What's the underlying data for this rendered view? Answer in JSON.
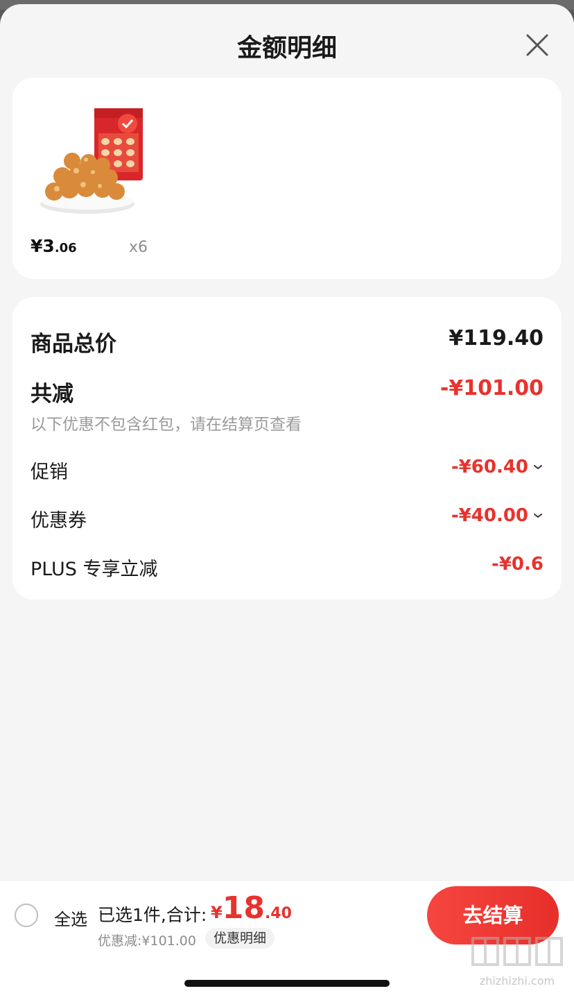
{
  "sheet": {
    "title": "金额明细"
  },
  "product": {
    "price_symbol": "¥",
    "price_integer": "3",
    "price_decimal": ".06",
    "quantity": "x6"
  },
  "summary": {
    "total_label": "商品总价",
    "total_value": "¥119.40",
    "reduce_label": "共减",
    "reduce_value": "-¥101.00",
    "note": "以下优惠不包含红包，请在结算页查看",
    "promo_label": "促销",
    "promo_value": "-¥60.40",
    "coupon_label": "优惠券",
    "coupon_value": "-¥40.00",
    "plus_label": "PLUS 专享立减",
    "plus_value": "-¥0.6"
  },
  "bottom_bar": {
    "select_all": "全选",
    "selected_text": "已选1件,合计:",
    "sum_symbol": "¥",
    "sum_integer": "18",
    "sum_decimal": ".40",
    "discount_text": "优惠减:¥101.00",
    "detail_chip": "优惠明细",
    "checkout": "去结算"
  },
  "watermark": {
    "text": "zhizhizhi.com"
  },
  "colors": {
    "accent_red": "#e8322d",
    "sheet_bg": "#f5f5f5",
    "card_bg": "#ffffff"
  }
}
